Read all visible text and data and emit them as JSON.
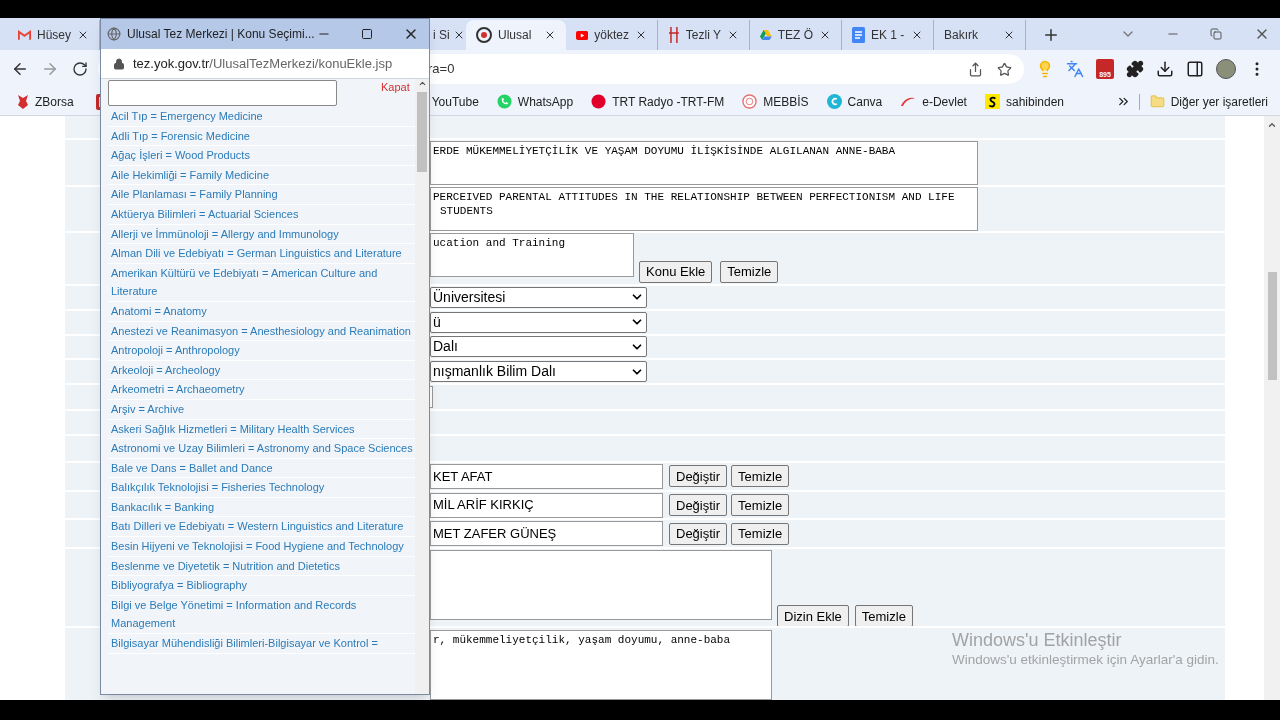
{
  "browser": {
    "tabs": [
      {
        "label": "Hüsey",
        "kind": "mail",
        "selected": false
      },
      {
        "label": "i Si",
        "kind": "plain",
        "selected": false
      },
      {
        "label": "Ulusal",
        "kind": "eye",
        "selected": true
      },
      {
        "label": "yöktez",
        "kind": "video",
        "selected": false
      },
      {
        "label": "Tezli Y",
        "kind": "fork",
        "selected": false
      },
      {
        "label": "TEZ Ö",
        "kind": "drive",
        "selected": false
      },
      {
        "label": "EK 1 -",
        "kind": "doc",
        "selected": false
      },
      {
        "label": "Bakırk",
        "kind": "plain",
        "selected": false
      }
    ],
    "address_fragment": "ra=0",
    "extension_badge": "895",
    "bookmarks": [
      {
        "label": "ZBorsa",
        "kind": "bull"
      },
      {
        "kind": "flag"
      },
      {
        "label": "YouTube",
        "kind": "plain"
      },
      {
        "label": "WhatsApp",
        "kind": "whatsapp"
      },
      {
        "label": "TRT Radyo -TRT-FM",
        "kind": "dot"
      },
      {
        "label": "MEBBİS",
        "kind": "seal"
      },
      {
        "label": "Canva",
        "kind": "canva"
      },
      {
        "label": "e-Devlet",
        "kind": "swoosh"
      },
      {
        "label": "sahibinden",
        "kind": "square"
      }
    ],
    "other_bookmarks": "Diğer yer işaretleri"
  },
  "page": {
    "title_tr_lines": [
      "ERDE MÜKEMMELİYETÇİLİK VE YAŞAM DOYUMU İLİŞKİSİNDE ALGILANAN ANNE-BABA"
    ],
    "title_en_lines": [
      "PERCEIVED PARENTAL ATTITUDES IN THE RELATIONSHIP BETWEEN PERFECTIONISM AND LIFE",
      "STUDENTS"
    ],
    "subject": "ucation and Training",
    "subject_buttons": [
      "Konu Ekle",
      "Temizle"
    ],
    "selects": [
      "Üniversitesi",
      "ü",
      "Dalı",
      "nışmanlık Bilim Dalı"
    ],
    "people": [
      {
        "name": "KET AFAT",
        "buttons": [
          "Değiştir",
          "Temizle"
        ]
      },
      {
        "name": "MİL ARİF KIRKIÇ",
        "buttons": [
          "Değiştir",
          "Temizle"
        ]
      },
      {
        "name": "MET ZAFER GÜNEŞ",
        "buttons": [
          "Değiştir",
          "Temizle"
        ]
      }
    ],
    "index_buttons": [
      "Dizin Ekle",
      "Temizle"
    ],
    "keywords": "r, mükemmeliyetçilik, yaşam doyumu, anne-baba"
  },
  "popup": {
    "title": "Ulusal Tez Merkezi | Konu Seçimi...",
    "url_host": "tez.yok.gov.tr",
    "url_path": "/UlusalTezMerkezi/konuEkle.jsp",
    "close_link": "Kapat",
    "items": [
      "Acil Tıp = Emergency Medicine",
      "Adli Tıp = Forensic Medicine",
      "Ağaç İşleri = Wood Products",
      "Aile Hekimliği = Family Medicine",
      "Aile Planlaması = Family Planning",
      "Aktüerya Bilimleri = Actuarial Sciences",
      "Allerji ve İmmünoloji = Allergy and Immunology",
      "Alman Dili ve Edebiyatı = German Linguistics and Literature",
      "Amerikan Kültürü ve Edebiyatı = American Culture and Literature",
      "Anatomi = Anatomy",
      "Anestezi ve Reanimasyon = Anesthesiology and Reanimation",
      "Antropoloji = Anthropology",
      "Arkeoloji = Archeology",
      "Arkeometri = Archaeometry",
      "Arşiv = Archive",
      "Askeri Sağlık Hizmetleri = Military Health Services",
      "Astronomi ve Uzay Bilimleri = Astronomy and Space Sciences",
      "Bale ve Dans = Ballet and Dance",
      "Balıkçılık Teknolojisi = Fisheries Technology",
      "Bankacılık = Banking",
      "Batı Dilleri ve Edebiyatı = Western Linguistics and Literature",
      "Besin Hijyeni ve Teknolojisi = Food Hygiene and Technology",
      "Beslenme ve Diyetetik = Nutrition and Dietetics",
      "Bibliyografya = Bibliography",
      "Bilgi ve Belge Yönetimi = Information and Records Management",
      "Bilgisayar Mühendisliği Bilimleri-Bilgisayar ve Kontrol ="
    ]
  },
  "watermark": {
    "title": "Windows'u Etkinleştir",
    "text": "Windows'u etkinleştirmek için Ayarlar'a gidin."
  }
}
